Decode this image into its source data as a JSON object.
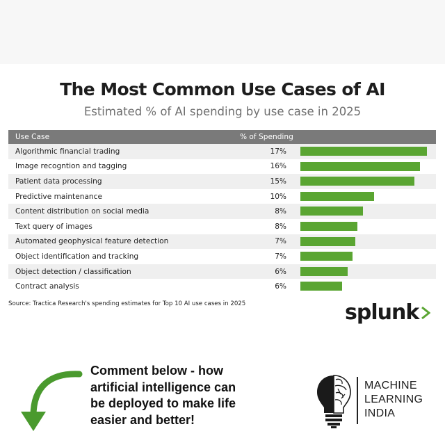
{
  "title": "The Most Common Use Cases of AI",
  "subtitle": "Estimated % of AI spending by use case in 2025",
  "table": {
    "col_use_case": "Use Case",
    "col_spending": "% of Spending"
  },
  "chart_data": {
    "type": "bar",
    "orientation": "horizontal",
    "title": "The Most Common Use Cases of AI",
    "subtitle": "Estimated % of AI spending by use case in 2025",
    "categories": [
      "Algorithmic financial trading",
      "Image recogntion and tagging",
      "Patient data processing",
      "Predictive maintenance",
      "Content distribution on social media",
      "Text query of images",
      "Automated geophysical feature detection",
      "Object identification and tracking",
      "Object detection / classification",
      "Contract analysis"
    ],
    "values": [
      17,
      16,
      15,
      10,
      8,
      8,
      7,
      7,
      6,
      6
    ],
    "value_labels": [
      "17%",
      "16%",
      "15%",
      "10%",
      "8%",
      "8%",
      "7%",
      "7%",
      "6%",
      "6%"
    ],
    "bar_lengths": [
      17.2,
      16.3,
      15.5,
      10,
      8.5,
      7.8,
      7.5,
      7.1,
      6.4,
      5.7
    ],
    "xlim": [
      0,
      17.5
    ],
    "bar_color": "#5aa532"
  },
  "source": "Source: Tractica Research's spending estimates for Top 10 AI use cases in 2025",
  "brand": {
    "name": "splunk",
    "chevron_color": "#5aa532"
  },
  "cta": {
    "lines": [
      "Comment below - how",
      "artificial intelligence can",
      "be deployed to make life",
      "easier and better!"
    ],
    "arrow_color": "#4a9a2e",
    "arrow_icon": "curved-down-arrow-icon"
  },
  "mli": {
    "lines": [
      "MACHINE",
      "LEARNING",
      "INDIA"
    ],
    "logo_icon": "brain-lightbulb-icon"
  }
}
